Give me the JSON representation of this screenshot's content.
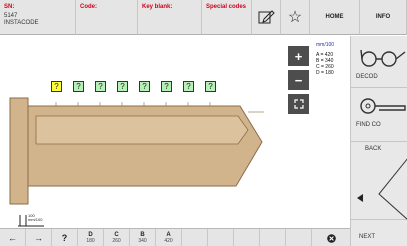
{
  "header": {
    "sn_label": "SN:",
    "sn_value": "5147\nINSTACODE",
    "code_label": "Code:",
    "key_blank_label": "Key blank:",
    "special_codes_label": "Special codes",
    "home_label": "HOME",
    "info_label": "INFO"
  },
  "cuts": [
    "?",
    "?",
    "?",
    "?",
    "?",
    "?",
    "?",
    "?"
  ],
  "measure": {
    "unit": "mm/100",
    "lines": [
      "A = 420",
      "B = 340",
      "C = 260",
      "D = 180"
    ]
  },
  "scale": {
    "value": "100",
    "unit": "mm/100"
  },
  "right_panel": {
    "decode_label": "DECOD",
    "find_code_label": "FIND CO",
    "back_label": "BACK",
    "next_label": "NEXT"
  },
  "bottom_bar": {
    "help": "?",
    "depths": [
      {
        "letter": "D",
        "value": "180"
      },
      {
        "letter": "C",
        "value": "260"
      },
      {
        "letter": "B",
        "value": "340"
      },
      {
        "letter": "A",
        "value": "420"
      }
    ]
  },
  "colors": {
    "key_fill": "#d2b48c",
    "key_stroke": "#8a6d4a",
    "active_cut": "#ffff33",
    "inactive_cut": "#b7f0b7",
    "cut_border": "#333333"
  }
}
